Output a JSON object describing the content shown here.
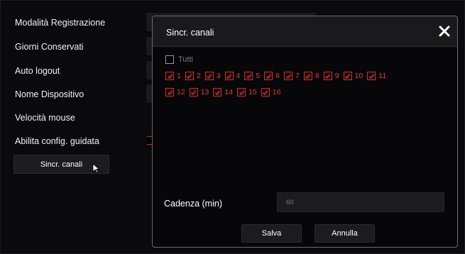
{
  "settings": {
    "labels": [
      "Modalità Registrazione",
      "Giorni Conservati",
      "Auto logout",
      "Nome Dispositivo",
      "Velocità mouse",
      "Abilita config. guidata"
    ],
    "sync_button_label": "Sincr. canali"
  },
  "modal": {
    "title": "Sincr. canali",
    "all_label": "Tutti",
    "channels_row1": [
      "1",
      "2",
      "3",
      "4",
      "5",
      "6",
      "7",
      "8",
      "9",
      "10",
      "11"
    ],
    "channels_row2": [
      "12",
      "13",
      "14",
      "15",
      "16"
    ],
    "cadence_label": "Cadenza (min)",
    "cadence_value": "60",
    "save_label": "Salva",
    "cancel_label": "Annulla"
  },
  "colors": {
    "accent_red": "#e53935",
    "background": "#0a0a0c",
    "panel": "#1c1c20"
  }
}
